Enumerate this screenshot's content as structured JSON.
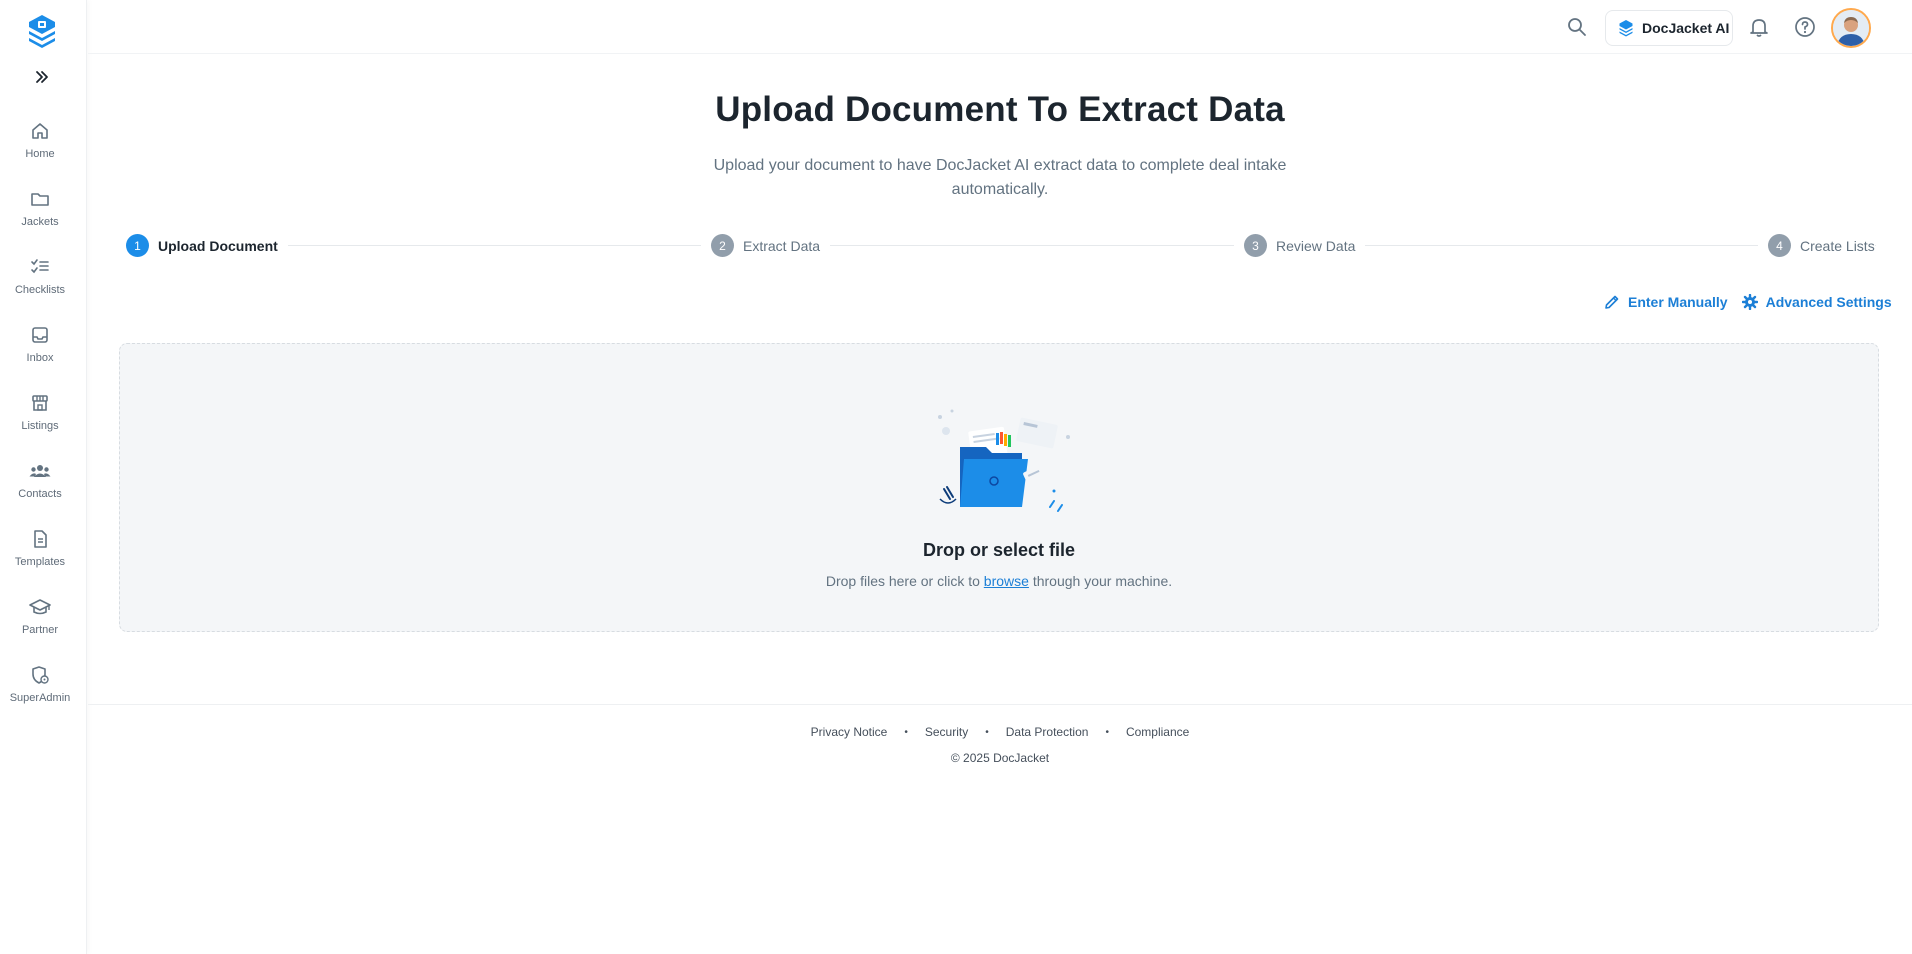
{
  "sidebar": {
    "items": [
      {
        "label": "Home",
        "icon": "home-icon"
      },
      {
        "label": "Jackets",
        "icon": "folder-icon"
      },
      {
        "label": "Checklists",
        "icon": "checklist-icon"
      },
      {
        "label": "Inbox",
        "icon": "inbox-icon"
      },
      {
        "label": "Listings",
        "icon": "store-icon"
      },
      {
        "label": "Contacts",
        "icon": "people-icon"
      },
      {
        "label": "Templates",
        "icon": "document-icon"
      },
      {
        "label": "Partner",
        "icon": "graduation-cap-icon"
      },
      {
        "label": "SuperAdmin",
        "icon": "shield-settings-icon"
      }
    ]
  },
  "header": {
    "ai_button_label": "DocJacket AI"
  },
  "main": {
    "title": "Upload Document To Extract Data",
    "subtitle": "Upload your document to have DocJacket AI extract data to complete deal intake automatically.",
    "steps": [
      {
        "number": "1",
        "label": "Upload Document",
        "active": true
      },
      {
        "number": "2",
        "label": "Extract Data",
        "active": false
      },
      {
        "number": "3",
        "label": "Review Data",
        "active": false
      },
      {
        "number": "4",
        "label": "Create Lists",
        "active": false
      }
    ],
    "actions": {
      "enter_manually": "Enter Manually",
      "advanced_settings": "Advanced Settings"
    },
    "dropzone": {
      "title": "Drop or select file",
      "sub_before": "Drop files here or click to ",
      "sub_link": "browse",
      "sub_after": " through your machine."
    }
  },
  "footer": {
    "links": [
      "Privacy Notice",
      "Security",
      "Data Protection",
      "Compliance"
    ],
    "separator": "•",
    "copyright": "© 2025 DocJacket"
  },
  "colors": {
    "primary": "#1c8de8",
    "link": "#1c7fd6",
    "text": "#1c252e",
    "muted": "#637381"
  }
}
